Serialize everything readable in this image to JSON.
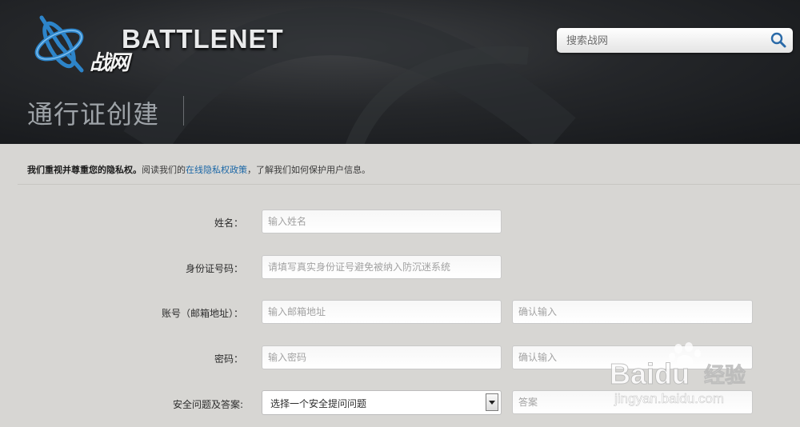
{
  "header": {
    "logo_wordmark": "BATTLENET",
    "logo_cn": "战网",
    "search": {
      "placeholder": "搜索战网"
    },
    "page_title": "通行证创建"
  },
  "privacy": {
    "strong": "我们重视并尊重您的隐私权。",
    "lead": "阅读我们的",
    "link": "在线隐私权政策",
    "tail": "，了解我们如何保护用户信息。"
  },
  "form": {
    "name": {
      "label": "姓名：",
      "placeholder": "输入姓名"
    },
    "id_number": {
      "label": "身份证号码：",
      "placeholder": "请填写真实身份证号避免被纳入防沉迷系统"
    },
    "account": {
      "label": "账号（邮箱地址）：",
      "placeholder": "输入邮箱地址",
      "confirm_placeholder": "确认输入"
    },
    "password": {
      "label": "密码：",
      "placeholder": "输入密码",
      "confirm_placeholder": "确认输入"
    },
    "security": {
      "label": "安全问题及答案:",
      "selected": "选择一个安全提问问题",
      "answer_placeholder": "答案"
    }
  },
  "watermark": {
    "brand": "Baidu",
    "cn": "经验",
    "url": "jingyan.baidu.com"
  },
  "colors": {
    "link": "#1b67a6",
    "header_bg": "#1e2023",
    "content_bg": "#d7d6d3",
    "logo_blue": "#2d84c9"
  }
}
